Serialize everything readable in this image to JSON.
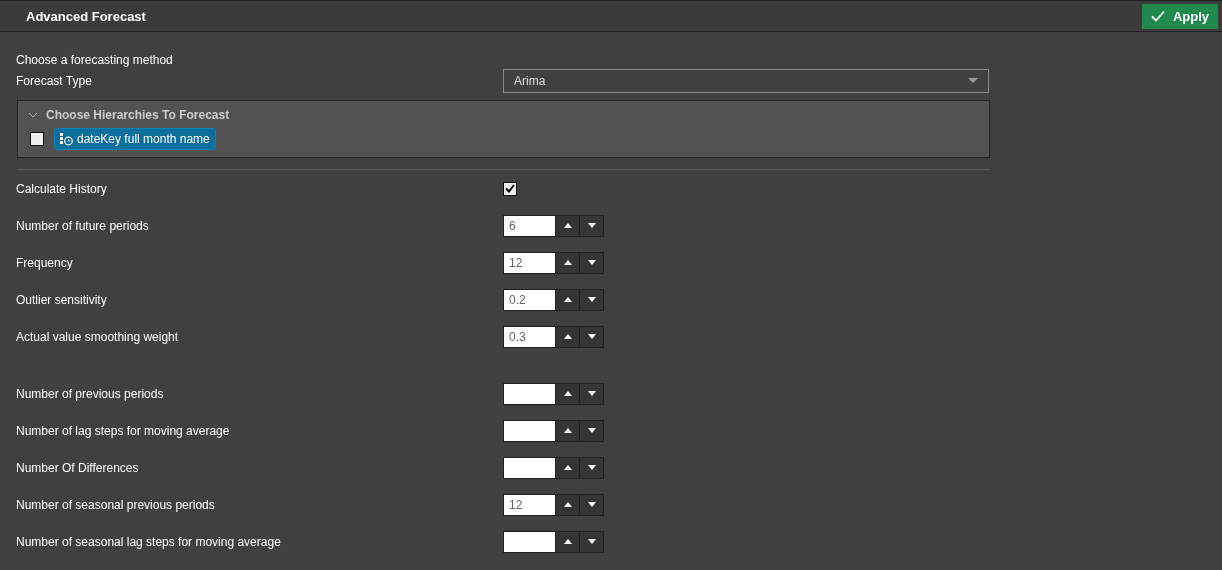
{
  "header": {
    "title": "Advanced Forecast",
    "apply_button": "Apply"
  },
  "method": {
    "heading": "Choose a forecasting method",
    "forecast_type_label": "Forecast Type",
    "forecast_type_value": "Arima"
  },
  "hierarchies": {
    "title": "Choose Hierarchies To Forecast",
    "expanded": true,
    "items": [
      {
        "label": "dateKey full month name",
        "checked": false
      }
    ]
  },
  "settings": [
    {
      "kind": "checkbox",
      "label": "Calculate History",
      "checked": true
    },
    {
      "kind": "number",
      "label": "Number of future periods",
      "value": "6"
    },
    {
      "kind": "number",
      "label": "Frequency",
      "value": "12"
    },
    {
      "kind": "number",
      "label": "Outlier sensitivity",
      "value": "0.2"
    },
    {
      "kind": "number",
      "label": "Actual value smoothing weight",
      "value": "0.3"
    }
  ],
  "advanced_settings": [
    {
      "kind": "number",
      "label": "Number of previous periods"
    },
    {
      "kind": "number",
      "label": "Number of lag steps for moving average"
    },
    {
      "kind": "number",
      "label": "Number Of Differences"
    },
    {
      "kind": "number",
      "label": "Number of seasonal previous periods",
      "value": "12"
    },
    {
      "kind": "number",
      "label": "Number of seasonal lag steps for moving average"
    }
  ]
}
